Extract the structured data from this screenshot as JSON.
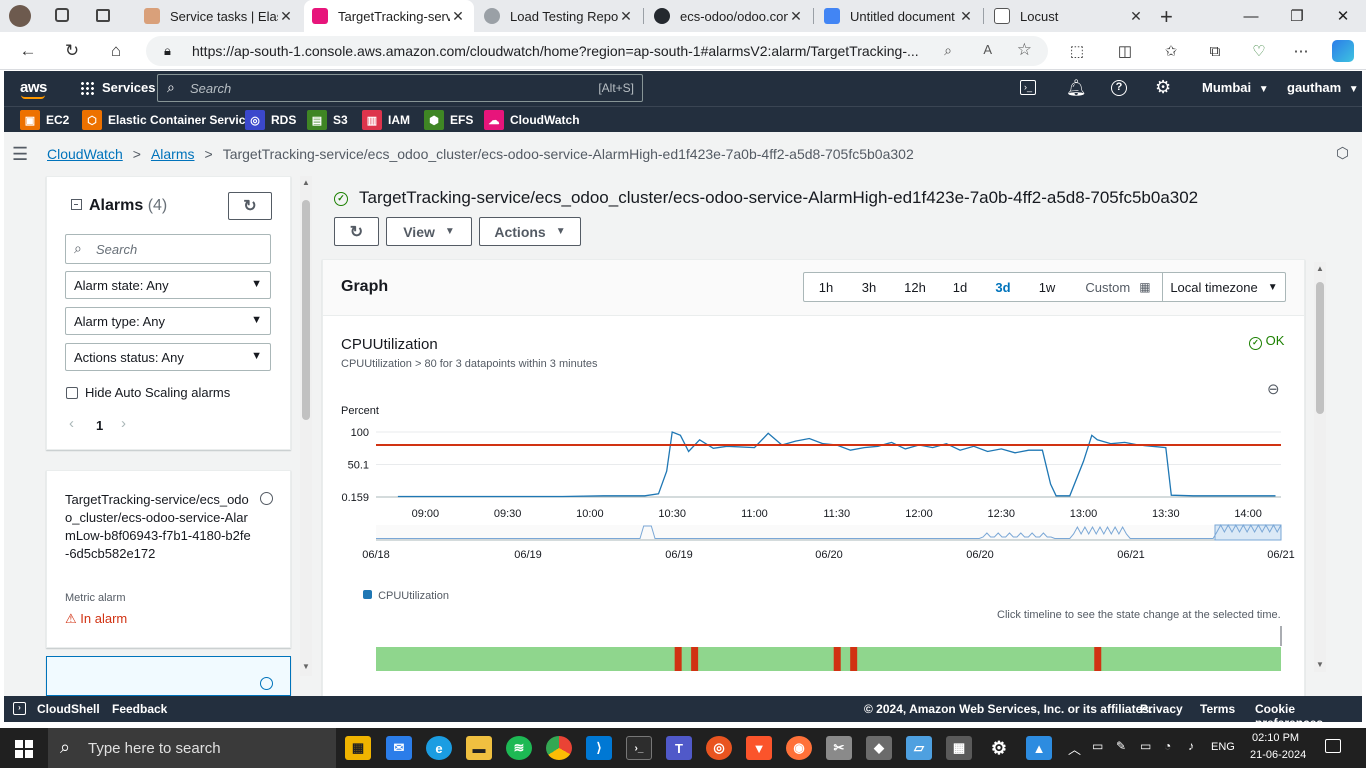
{
  "browser": {
    "tabs": [
      {
        "title": "Service tasks | Elasti",
        "icon": "ecs-icon"
      },
      {
        "title": "TargetTracking-serv",
        "icon": "cloudwatch-icon"
      },
      {
        "title": "Load Testing Report",
        "icon": "gear-icon"
      },
      {
        "title": "ecs-odoo/odoo.con",
        "icon": "github-icon"
      },
      {
        "title": "Untitled document",
        "icon": "docs-icon"
      },
      {
        "title": "Locust",
        "icon": "page-icon"
      }
    ],
    "new_tab": "+",
    "url": "https://ap-south-1.console.aws.amazon.com/cloudwatch/home?region=ap-south-1#alarmsV2:alarm/TargetTracking-..."
  },
  "aws_header": {
    "logo": "aws",
    "services_label": "Services",
    "search_placeholder": "Search",
    "search_shortcut": "[Alt+S]",
    "region": "Mumbai",
    "user": "gautham",
    "favorites": [
      {
        "label": "EC2",
        "color": "#ed7100"
      },
      {
        "label": "Elastic Container Service",
        "color": "#ed7100"
      },
      {
        "label": "RDS",
        "color": "#3b48cc"
      },
      {
        "label": "S3",
        "color": "#3f8624"
      },
      {
        "label": "IAM",
        "color": "#dd344c"
      },
      {
        "label": "EFS",
        "color": "#3f8624"
      },
      {
        "label": "CloudWatch",
        "color": "#e7157b"
      }
    ]
  },
  "breadcrumb": {
    "items": [
      "CloudWatch",
      "Alarms"
    ],
    "current": "TargetTracking-service/ecs_odoo_cluster/ecs-odoo-service-AlarmHigh-ed1f423e-7a0b-4ff2-a5d8-705fc5b0a302"
  },
  "alarms_panel": {
    "title": "Alarms",
    "count": "(4)",
    "search_placeholder": "Search",
    "filters": [
      "Alarm state: Any",
      "Alarm type: Any",
      "Actions status: Any"
    ],
    "hide_autoscaling_label": "Hide Auto Scaling alarms",
    "page": "1",
    "card": {
      "name": "TargetTracking-service/ecs_odoo_cluster/ecs-odoo-service-AlarmLow-b8f06943-f7b1-4180-b2fe-6d5cb582e172",
      "type": "Metric alarm",
      "state": "In alarm"
    }
  },
  "detail": {
    "title": "TargetTracking-service/ecs_odoo_cluster/ecs-odoo-service-AlarmHigh-ed1f423e-7a0b-4ff2-a5d8-705fc5b0a302",
    "view_label": "View",
    "actions_label": "Actions",
    "graph_heading": "Graph",
    "ranges": [
      "1h",
      "3h",
      "12h",
      "1d",
      "3d",
      "1w",
      "Custom"
    ],
    "selected_range": "3d",
    "timezone": "Local timezone",
    "metric_name": "CPUUtilization",
    "condition": "CPUUtilization > 80 for 3 datapoints within 3 minutes",
    "status": "OK",
    "timeline_hint": "Click timeline to see the state change at the selected time.",
    "legend_label": "CPUUtilization"
  },
  "chart_data": {
    "type": "line",
    "title": "CPUUtilization",
    "ylabel": "Percent",
    "y_ticks": [
      "100",
      "50.1",
      "0.159"
    ],
    "x_ticks": [
      "09:00",
      "09:30",
      "10:00",
      "10:30",
      "11:00",
      "11:30",
      "12:00",
      "12:30",
      "13:00",
      "13:30",
      "14:00"
    ],
    "navigator_ticks": [
      "06/18",
      "06/19",
      "06/19",
      "06/20",
      "06/20",
      "06/21",
      "06/21"
    ],
    "threshold": 80,
    "threshold_color": "#d13212",
    "series": [
      {
        "name": "CPUUtilization",
        "color": "#1f77b4",
        "x": [
          "08:50",
          "09:10",
          "09:30",
          "09:50",
          "10:05",
          "10:20",
          "10:25",
          "10:28",
          "10:30",
          "10:33",
          "10:36",
          "10:40",
          "10:45",
          "10:50",
          "11:00",
          "11:05",
          "11:10",
          "11:15",
          "11:20",
          "11:25",
          "11:30",
          "11:35",
          "11:40",
          "11:45",
          "11:50",
          "11:55",
          "12:00",
          "12:05",
          "12:10",
          "12:15",
          "12:20",
          "12:25",
          "12:30",
          "12:35",
          "12:40",
          "12:45",
          "12:48",
          "12:50",
          "12:55",
          "13:00",
          "13:03",
          "13:05",
          "13:10",
          "13:15",
          "13:20",
          "13:25",
          "13:30",
          "13:32",
          "13:40",
          "13:50",
          "14:00",
          "14:10"
        ],
        "values": [
          1,
          1,
          1,
          1,
          2,
          2,
          5,
          40,
          100,
          95,
          70,
          88,
          75,
          78,
          76,
          98,
          80,
          86,
          90,
          82,
          80,
          72,
          76,
          78,
          84,
          74,
          80,
          76,
          82,
          72,
          78,
          70,
          74,
          68,
          72,
          72,
          20,
          2,
          2,
          55,
          95,
          88,
          82,
          84,
          80,
          78,
          76,
          3,
          2,
          2,
          2,
          2
        ]
      }
    ],
    "alarm_timeline": {
      "default_state": "OK",
      "ok_color": "#8fd68d",
      "alarm_color": "#d13212",
      "alarm_times": [
        "10:32",
        "10:38",
        "11:30",
        "11:36",
        "13:05"
      ]
    }
  },
  "footer": {
    "cloudshell": "CloudShell",
    "feedback": "Feedback",
    "copyright": "© 2024, Amazon Web Services, Inc. or its affiliates.",
    "privacy": "Privacy",
    "terms": "Terms",
    "cookies": "Cookie preferences"
  },
  "taskbar": {
    "search_placeholder": "Type here to search",
    "lang": "ENG",
    "time": "02:10 PM",
    "date": "21-06-2024"
  }
}
